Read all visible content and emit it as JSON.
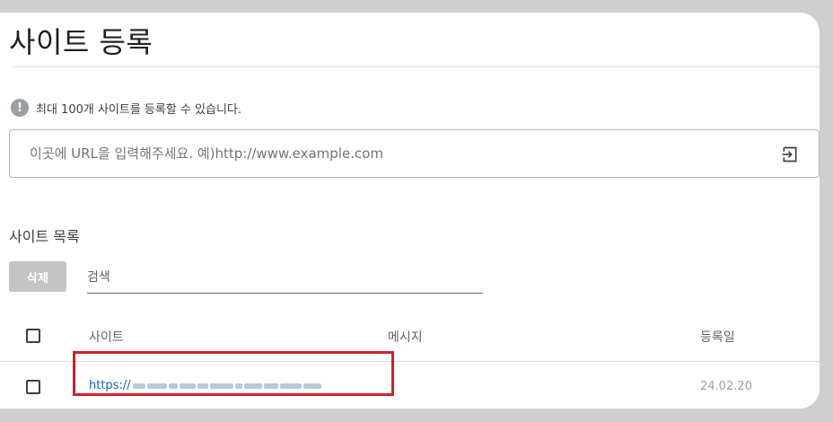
{
  "page": {
    "title": "사이트 등록"
  },
  "notice": {
    "icon": "info-icon",
    "icon_glyph": "!",
    "text": "최대 100개 사이트를 등록할 수 있습니다."
  },
  "url_input": {
    "value": "",
    "placeholder": "이곳에 URL을 입력해주세요. 예)http://www.example.com",
    "submit_icon": "enter-icon"
  },
  "site_list": {
    "title": "사이트 목록",
    "delete_label": "삭제",
    "search_placeholder": "검색",
    "search_value": "",
    "columns": {
      "site": "사이트",
      "message": "메시지",
      "date": "등록일"
    },
    "rows": [
      {
        "site": "https://",
        "message": "",
        "date": "24.02.20",
        "checked": false
      }
    ]
  },
  "colors": {
    "link": "#1a5fb4",
    "highlight": "#d0202a",
    "button_disabled": "#c4c4c4"
  }
}
